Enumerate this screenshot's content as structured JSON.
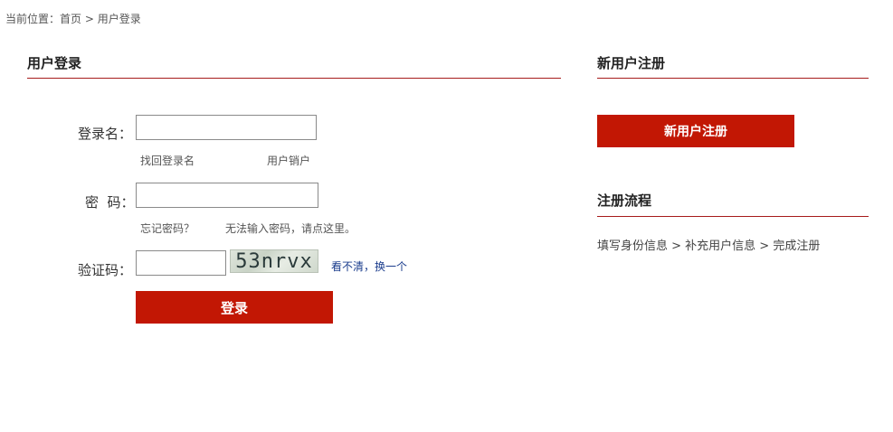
{
  "breadcrumb": {
    "prefix": "当前位置：",
    "home": "首页",
    "separator": " > ",
    "current": "用户登录"
  },
  "login": {
    "title": "用户登录",
    "username_label": "登录名：",
    "username_value": "",
    "find_username": "找回登录名",
    "cancel_account": "用户销户",
    "password_label": "密  码：",
    "password_value": "",
    "forgot_password": "忘记密码？",
    "cannot_input": "无法输入密码，请点这里。",
    "captcha_label": "验证码：",
    "captcha_value": "",
    "captcha_text": "53nrvx",
    "captcha_refresh": "看不清，换一个",
    "submit_label": "登录"
  },
  "register": {
    "title": "新用户注册",
    "button_label": "新用户注册",
    "flow_title": "注册流程",
    "flow_steps": "填写身份信息 > 补充用户信息 > 完成注册"
  },
  "colors": {
    "accent": "#c21704",
    "rule": "#a61b1b",
    "link_blue": "#1a3c8c"
  }
}
